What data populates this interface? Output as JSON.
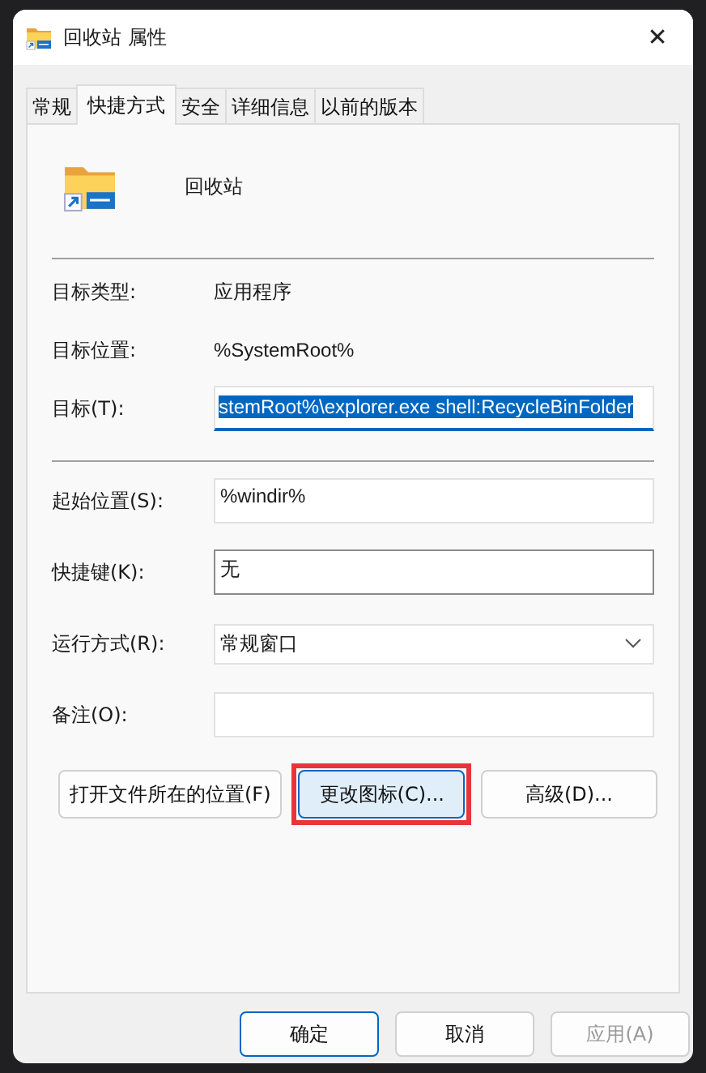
{
  "window": {
    "title": "回收站 属性",
    "close": "✕"
  },
  "tabs": [
    {
      "label": "常规",
      "selected": false
    },
    {
      "label": "快捷方式",
      "selected": true
    },
    {
      "label": "安全",
      "selected": false
    },
    {
      "label": "详细信息",
      "selected": false
    },
    {
      "label": "以前的版本",
      "selected": false
    }
  ],
  "shortcut": {
    "name": "回收站"
  },
  "info": [
    {
      "label": "目标类型:",
      "value": "应用程序"
    },
    {
      "label": "目标位置:",
      "value": "%SystemRoot%"
    }
  ],
  "target": {
    "label": "目标(T):",
    "value": "stemRoot%\\explorer.exe shell:RecycleBinFolder",
    "selected": true
  },
  "fields": [
    {
      "kind": "text",
      "label": "起始位置(S):",
      "value": "%windir%"
    },
    {
      "kind": "hotkey",
      "label": "快捷键(K):",
      "value": "无"
    },
    {
      "kind": "dropdown",
      "label": "运行方式(R):",
      "value": "常规窗口"
    },
    {
      "kind": "text",
      "label": "备注(O):"
    }
  ],
  "actions": [
    {
      "label": "打开文件所在的位置(F)",
      "highlighted": false
    },
    {
      "label": "更改图标(C)...",
      "highlighted": true
    },
    {
      "label": "高级(D)...",
      "highlighted": false
    }
  ],
  "buttons": [
    {
      "label": "确定",
      "default": true,
      "disabled": false
    },
    {
      "label": "取消",
      "default": false,
      "disabled": false
    },
    {
      "label": "应用(A)",
      "default": false,
      "disabled": true
    }
  ]
}
